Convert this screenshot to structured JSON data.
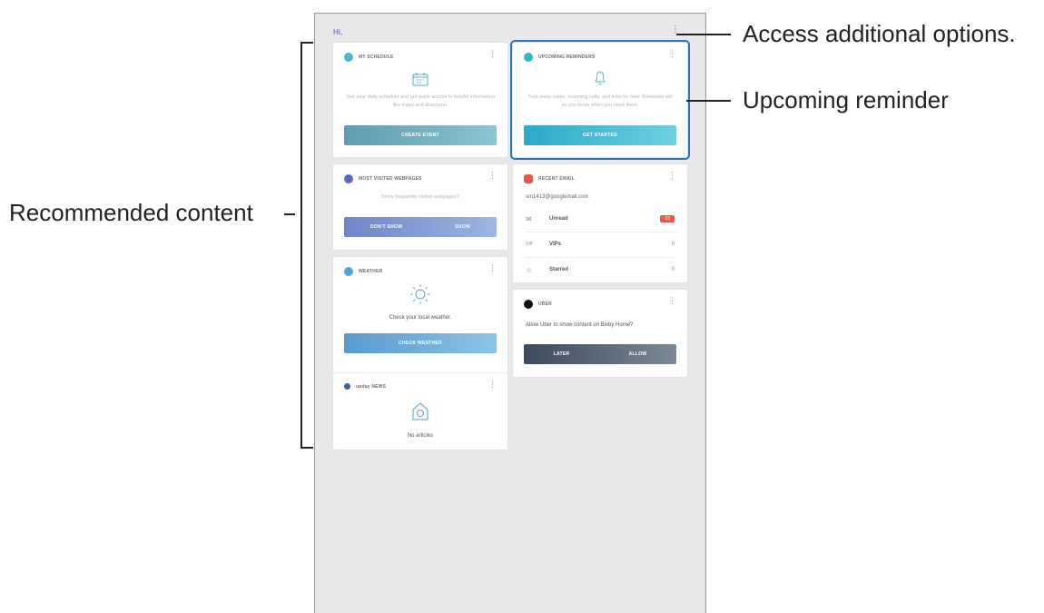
{
  "greeting": "Hi, ",
  "cards": {
    "schedule": {
      "title": "MY SCHEDULE",
      "desc": "See your daily schedule and get quick access to helpful information like maps and directions.",
      "button": "CREATE EVENT"
    },
    "reminders": {
      "title": "UPCOMING REMINDERS",
      "desc": "Tuck away notes, incoming calls, and links for later. Reminder will let you know when you need them.",
      "button": "GET STARTED"
    },
    "webpages": {
      "title": "MOST VISITED WEBPAGES",
      "desc": "Show frequently visited webpages?",
      "btn_left": "DON'T SHOW",
      "btn_right": "SHOW"
    },
    "email": {
      "title": "RECENT EMAIL",
      "account": "sm1413@googlemail.com",
      "rows": [
        {
          "icon": "✉",
          "label": "Unread",
          "count": "23"
        },
        {
          "icon": "VIP",
          "label": "VIPs",
          "count": "0"
        },
        {
          "icon": "☆",
          "label": "Starred",
          "count": "0"
        }
      ]
    },
    "weather": {
      "title": "WEATHER",
      "desc": "Check your local weather.",
      "button": "CHECK WEATHER"
    },
    "uber": {
      "title": "UBER",
      "desc": "Allow Uber to show content on Bixby Home?",
      "btn_left": "LATER",
      "btn_right": "ALLOW"
    },
    "news": {
      "title": "upday NEWS",
      "desc": "No articles"
    }
  },
  "callouts": {
    "options": "Access additional options.",
    "reminder": "Upcoming reminder",
    "recommended": "Recommended content"
  },
  "colors": {
    "schedule_btn": "#6aa6b8",
    "reminder_btn": "#3bb3cf",
    "webpages_btn": "#7b93cf",
    "weather_btn": "#5e9fd2",
    "uber_btn": "#4a5668",
    "highlight": "#2a78b8"
  }
}
